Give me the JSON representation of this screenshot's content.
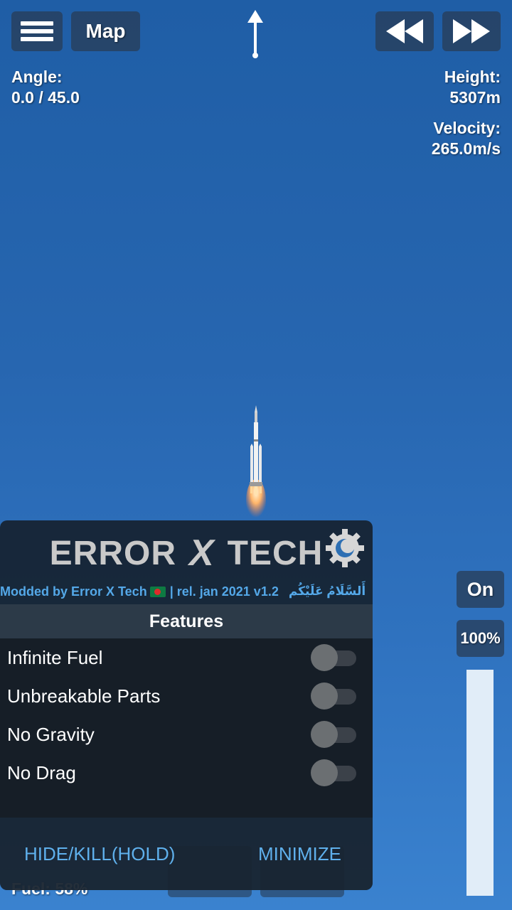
{
  "hud": {
    "map_label": "Map",
    "angle_label": "Angle:",
    "angle_value": "0.0 / 45.0",
    "height_label": "Height:",
    "height_value": "5307m",
    "velocity_label": "Velocity:",
    "velocity_value": "265.0m/s",
    "fuel_label": "Fuel: 58%"
  },
  "throttle": {
    "toggle_label": "On",
    "percent_label": "100%",
    "level": 1.0
  },
  "mod_panel": {
    "title_left": "ERROR",
    "title_x": "X",
    "title_right": "TECH",
    "credits": "Modded by Error X Tech",
    "release": "| rel. jan 2021 v1.2",
    "greeting": "أَلسَّلَامُ عَلَيْكُم",
    "features_header": "Features",
    "features": [
      {
        "label": "Infinite Fuel",
        "enabled": false
      },
      {
        "label": "Unbreakable Parts",
        "enabled": false
      },
      {
        "label": "No Gravity",
        "enabled": false
      },
      {
        "label": "No Drag",
        "enabled": false
      }
    ],
    "hide_label": "HIDE/KILL(HOLD)",
    "minimize_label": "MINIMIZE"
  },
  "colors": {
    "sky_top": "#1f5ea6",
    "sky_bottom": "#3a82cf",
    "accent_blue": "#54a8e8",
    "panel_bg": "#141e28"
  }
}
